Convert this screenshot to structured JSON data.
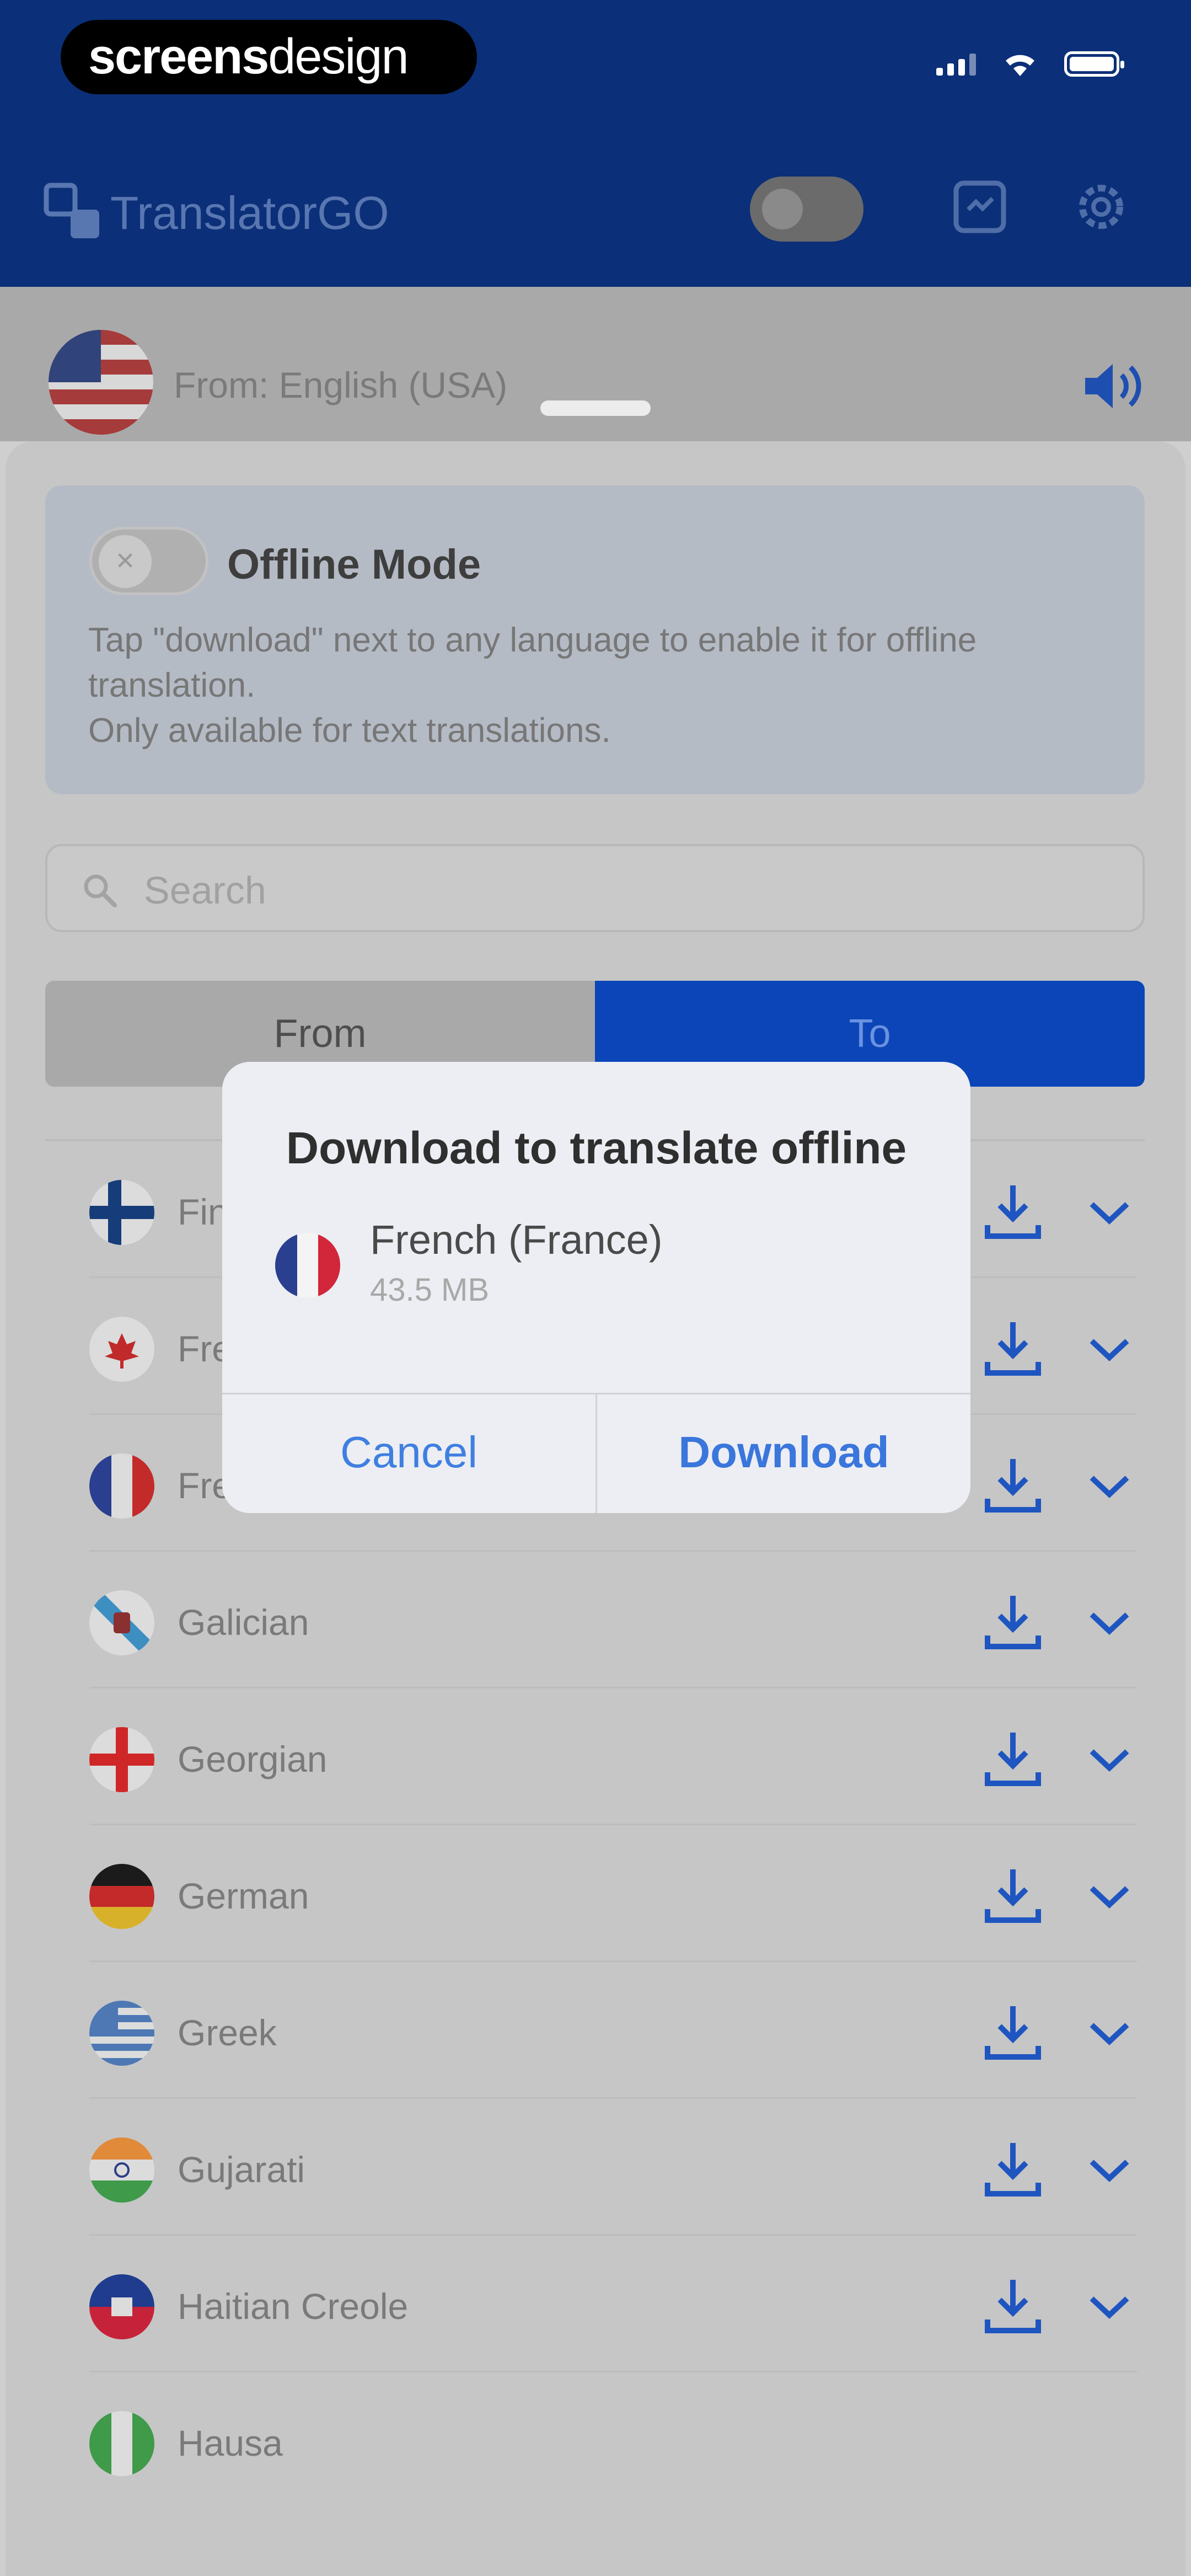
{
  "watermark": {
    "bold": "screens",
    "light": "design"
  },
  "app": {
    "title": "TranslatorGO"
  },
  "from_row": {
    "label": "From: English (USA)"
  },
  "offline": {
    "title": "Offline Mode",
    "description_1": "Tap \"download\" next to any language to enable it for offline translation.",
    "description_2": "Only available for text translations.",
    "toggle_glyph": "✕"
  },
  "search": {
    "placeholder": "Search"
  },
  "segment": {
    "from": "From",
    "to": "To"
  },
  "languages": [
    {
      "name": "Finnish",
      "flag": "finland"
    },
    {
      "name": "French (Canada)",
      "flag": "canada"
    },
    {
      "name": "French (France)",
      "flag": "france"
    },
    {
      "name": "Galician",
      "flag": "galicia"
    },
    {
      "name": "Georgian",
      "flag": "georgia"
    },
    {
      "name": "German",
      "flag": "germany"
    },
    {
      "name": "Greek",
      "flag": "greece"
    },
    {
      "name": "Gujarati",
      "flag": "india"
    },
    {
      "name": "Haitian Creole",
      "flag": "haiti"
    },
    {
      "name": "Hausa",
      "flag": "nigeria"
    }
  ],
  "dialog": {
    "title": "Download to translate offline",
    "language": "French (France)",
    "size": "43.5 MB",
    "cancel": "Cancel",
    "download": "Download"
  },
  "colors": {
    "accent": "#0b45b8",
    "header": "#0b2f78",
    "link": "#3f7fe0"
  }
}
